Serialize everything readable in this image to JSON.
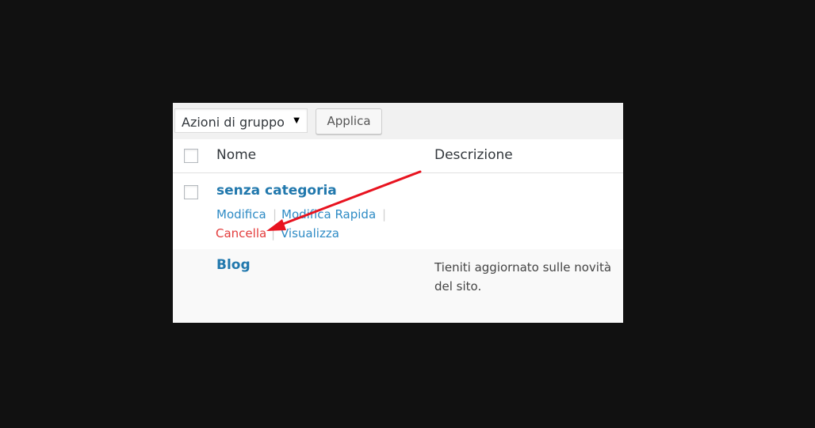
{
  "toolbar": {
    "bulk_actions_selected": "Azioni di gruppo",
    "apply_label": "Applica"
  },
  "table": {
    "columns": [
      "Nome",
      "Descrizione"
    ],
    "rows": [
      {
        "name": "senza categoria",
        "description": "",
        "actions": [
          "Modifica",
          "Modifica Rapida",
          "Cancella",
          "Visualizza"
        ]
      },
      {
        "name": "Blog",
        "description": "Tieniti aggiornato sulle novità del sito."
      }
    ]
  },
  "annotation": {
    "arrow_color": "#e8131f",
    "target": "Cancella"
  },
  "colors": {
    "link": "#2e8bc5",
    "title_link": "#2178ad",
    "delete": "#e33c3c",
    "background": "#111111"
  }
}
